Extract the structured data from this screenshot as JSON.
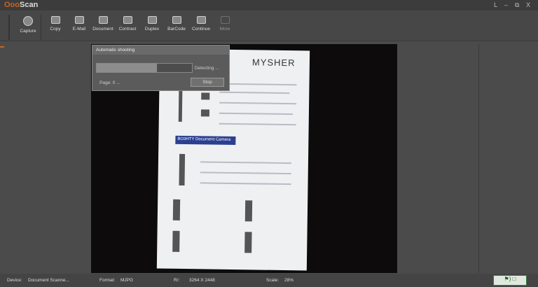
{
  "app": {
    "title_prefix": "Ooo",
    "title": "Scan"
  },
  "window_controls": {
    "l": "L",
    "minimize": "–",
    "restore": "⧉",
    "close": "X"
  },
  "toolbar": [
    {
      "id": "capture",
      "label": "Capture"
    },
    {
      "id": "copy",
      "label": "Copy"
    },
    {
      "id": "email",
      "label": "E-Mail"
    },
    {
      "id": "document",
      "label": "Document"
    },
    {
      "id": "contrast",
      "label": "Contrast"
    },
    {
      "id": "duplex",
      "label": "Duplex"
    },
    {
      "id": "barcode",
      "label": "BarCode"
    },
    {
      "id": "continue",
      "label": "Continue"
    },
    {
      "id": "more",
      "label": "More"
    }
  ],
  "preview": {
    "brand": "MYSHER",
    "banner": "BO3HTY Document Camera"
  },
  "dialog": {
    "title": "Automatic shooting",
    "progress_percent": 63,
    "status": "Detecting ...",
    "page_label": "Page:  0  ...",
    "stop_label": "Stop"
  },
  "status": {
    "device_label": "Device:",
    "device": "Document Scanne...",
    "format_label": "Format:",
    "format": "MJPG",
    "res_label": "R/:",
    "res": "3264 X 2448",
    "scale_label": "Scale:",
    "scale": "28%"
  },
  "tray": {
    "text": "⚑) □"
  }
}
